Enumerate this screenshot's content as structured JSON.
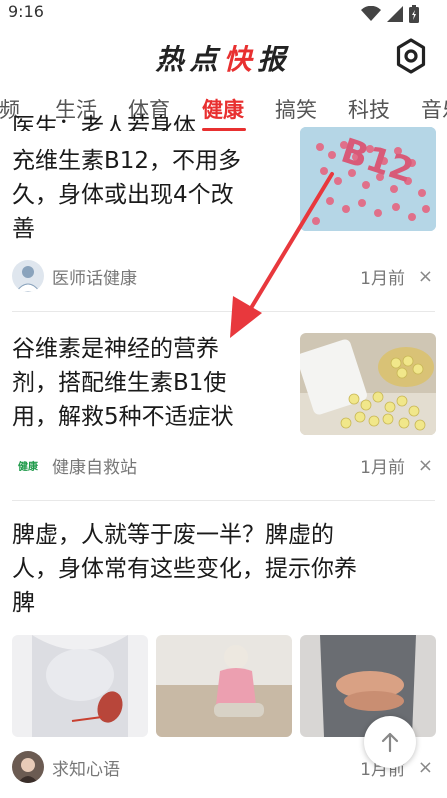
{
  "status_bar": {
    "time": "9:16"
  },
  "header": {
    "title_part1": "热点",
    "title_highlight": "快",
    "title_part2": "报"
  },
  "tabs": [
    {
      "label": "视频"
    },
    {
      "label": "生活"
    },
    {
      "label": "体育"
    },
    {
      "label": "健康"
    },
    {
      "label": "搞笑"
    },
    {
      "label": "科技"
    },
    {
      "label": "音乐"
    }
  ],
  "articles": [
    {
      "title_partial": "医生：老人若身体",
      "title_lines": [
        "充维生素B12，不用多",
        "久，身体或出现4个改",
        "善"
      ],
      "source": "医师话健康",
      "time": "1月前",
      "thumb_label": "B12"
    },
    {
      "title_lines": [
        "谷维素是神经的营养",
        "剂，搭配维生素B1使",
        "用，解救5种不适症状"
      ],
      "source": "健康自救站",
      "source_logo": "健康",
      "time": "1月前"
    },
    {
      "title_lines": [
        "脾虚，人就等于废一半？脾虚的",
        "人，身体常有这些变化，提示你养",
        "脾"
      ],
      "source": "求知心语",
      "time": "1月前"
    }
  ],
  "close_symbol": "×",
  "colors": {
    "accent": "#e83030",
    "annotation_arrow": "#e8383d"
  }
}
